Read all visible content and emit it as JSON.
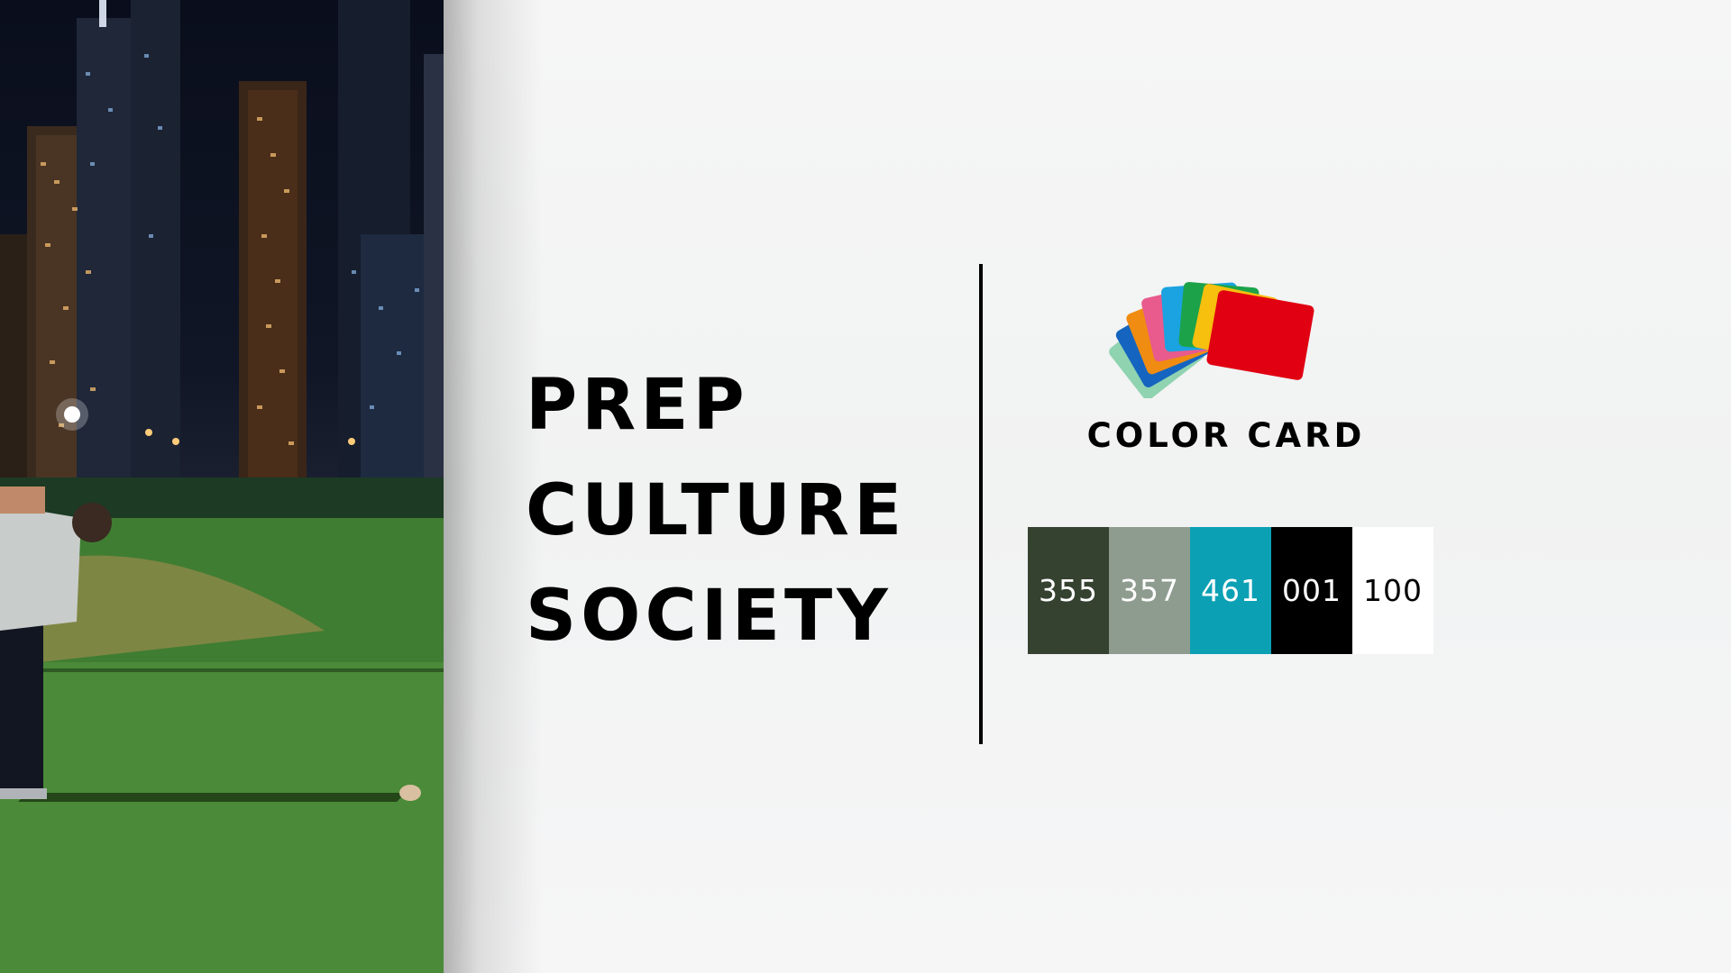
{
  "title": {
    "lines": [
      "PREP",
      "CULTURE",
      "SOCIETY"
    ]
  },
  "logo": {
    "label": "COLOR CARD",
    "card_colors": [
      "#8fd3b0",
      "#1565c0",
      "#f08c12",
      "#e85b8c",
      "#1aa3e0",
      "#1ca34a",
      "#f7bf0e",
      "#e00012"
    ]
  },
  "swatches": [
    {
      "code": "355",
      "color": "#354230",
      "text_color": "#ffffff"
    },
    {
      "code": "357",
      "color": "#8e9c8f",
      "text_color": "#ffffff"
    },
    {
      "code": "461",
      "color": "#0ba0b4",
      "text_color": "#ffffff"
    },
    {
      "code": "001",
      "color": "#000000",
      "text_color": "#ffffff"
    },
    {
      "code": "100",
      "color": "#ffffff",
      "text_color": "#000000"
    }
  ]
}
